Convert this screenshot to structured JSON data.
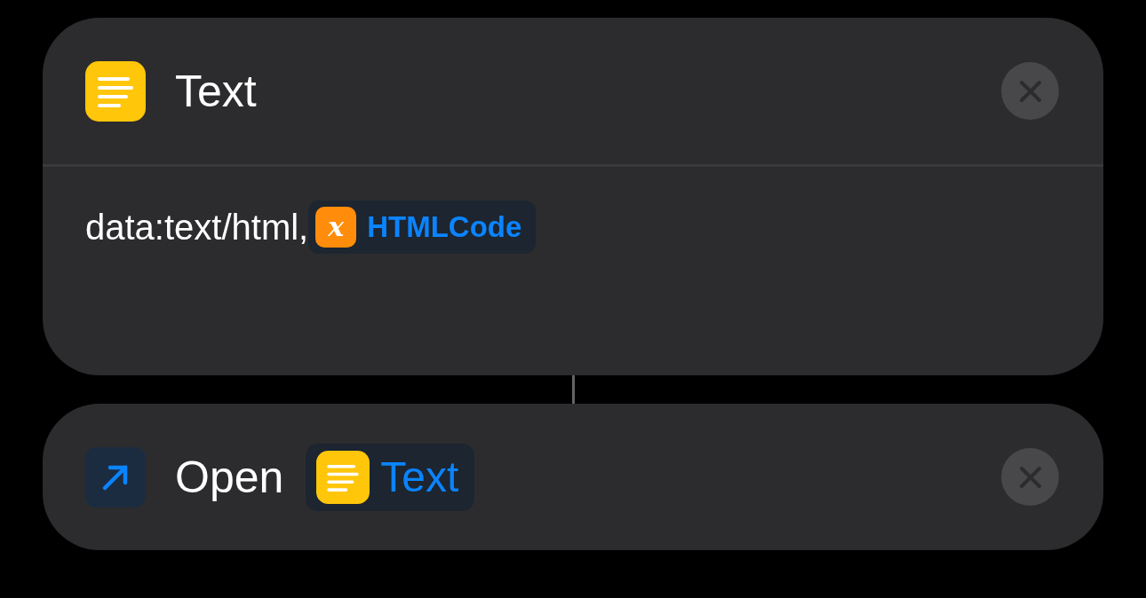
{
  "actions": [
    {
      "kind": "text",
      "title": "Text",
      "content": {
        "prefix": "data:text/html,",
        "variable": {
          "kind": "variable",
          "glyph": "x",
          "label": "HTMLCode"
        }
      }
    },
    {
      "kind": "open",
      "title": "Open",
      "parameter": {
        "kind": "text",
        "label": "Text"
      }
    }
  ]
}
